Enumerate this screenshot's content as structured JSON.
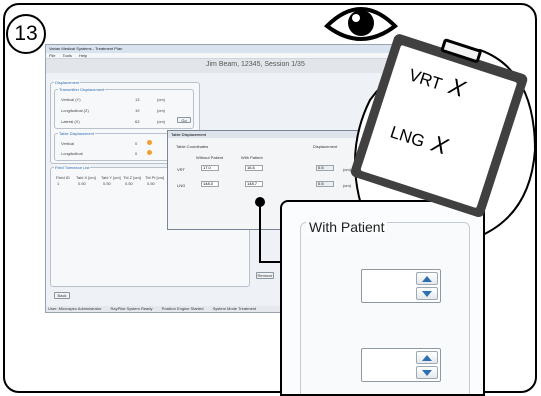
{
  "step": {
    "number": "13"
  },
  "app": {
    "title": "Varian Medical Systems - Treatment Plan",
    "menu": [
      "File",
      "Tools",
      "Help"
    ],
    "header": "Jim Beam, 12345, Session 1/35"
  },
  "displacement_group": {
    "title": "Displacement",
    "sub_title": "Transmitter Displacement",
    "rows": [
      {
        "label": "Vertical (Y)",
        "value": "13",
        "unit": "(cm)"
      },
      {
        "label": "Longitudinal (Z)",
        "value": "19",
        "unit": "(cm)"
      },
      {
        "label": "Lateral (X)",
        "value": "63",
        "unit": "(cm)"
      }
    ],
    "go_button": "Go"
  },
  "table_group": {
    "title": "Table Displacement",
    "rows": [
      {
        "label": "Vertical",
        "value": "0"
      },
      {
        "label": "Longitudinal",
        "value": "0"
      }
    ]
  },
  "field_group": {
    "title": "Field Tolerance List",
    "columns": [
      "Field ID",
      "Tabl X [cm]",
      "Tabl Y [cm]",
      "Tbl Z [cm]",
      "Tbl Pt [cm]"
    ],
    "row": [
      "1",
      "0.50",
      "0.50",
      "0.50",
      "0.50"
    ]
  },
  "dialog": {
    "title": "Table Displacement",
    "coordinator_label": "Table Coordinates",
    "col_without": "Without Patient",
    "col_with": "With Patient",
    "col_displacement": "Displacement",
    "rows": [
      {
        "label": "VRT",
        "without": "17.0",
        "with": "16.5",
        "disp": "0.5",
        "unit": "(cm)"
      },
      {
        "label": "LNG",
        "without": "148.0",
        "with": "148.7",
        "disp": "0.5",
        "unit": "(cm)"
      }
    ]
  },
  "buttons": {
    "remove": "Remove",
    "back": "Back"
  },
  "status_bar": [
    "User: Microspec Administrator",
    "RayPilot System Ready",
    "Position Engine Started",
    "System Mode Treatment"
  ],
  "clipboard": {
    "line1": "VRT",
    "mark1": "X",
    "line2": "LNG",
    "mark2": "X"
  },
  "zoom": {
    "title": "With Patient"
  }
}
